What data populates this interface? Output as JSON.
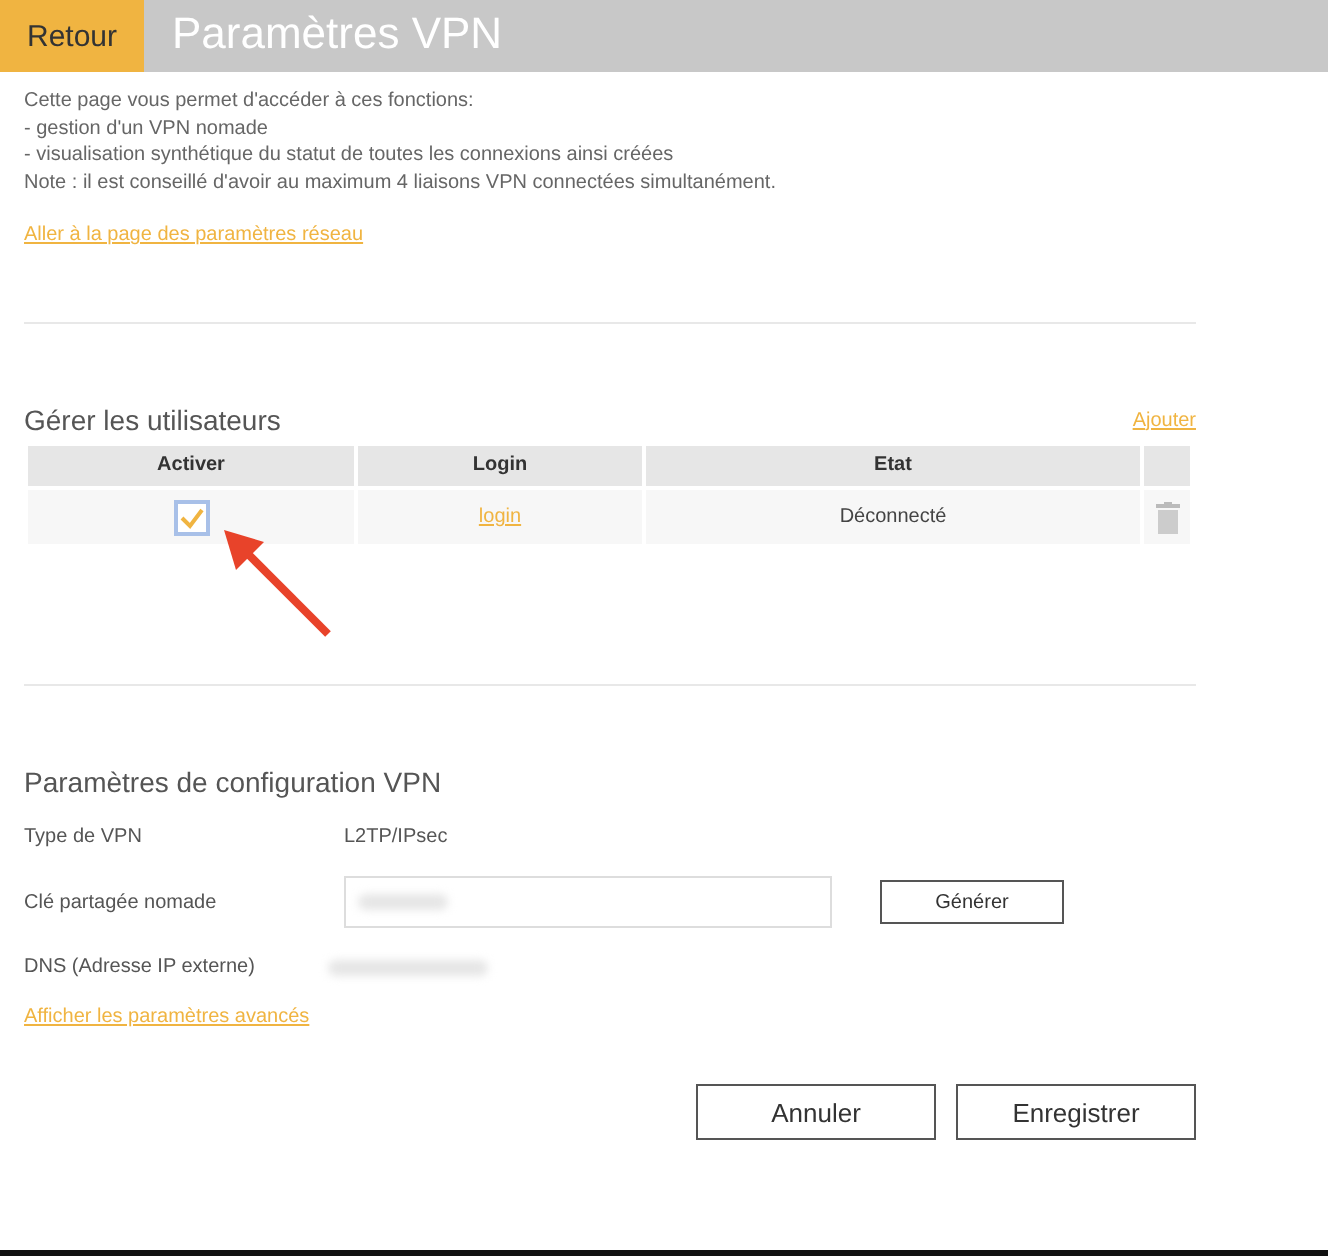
{
  "header": {
    "back_button": "Retour",
    "title": "Paramètres VPN"
  },
  "intro": {
    "lines": [
      "Cette page vous permet d'accéder à ces fonctions:",
      "- gestion d'un VPN nomade",
      "- visualisation synthétique du statut de toutes les connexions ainsi créées",
      "Note : il est conseillé d'avoir au maximum 4 liaisons VPN connectées simultanément."
    ],
    "link": "Aller à la page des paramètres réseau"
  },
  "users": {
    "title": "Gérer les utilisateurs",
    "add_link": "Ajouter",
    "columns": [
      "Activer",
      "Login",
      "Etat"
    ],
    "rows": [
      {
        "checked": true,
        "login": "login",
        "state": "Déconnecté"
      }
    ]
  },
  "config": {
    "title": "Paramètres de configuration VPN",
    "vpn_type_label": "Type de VPN",
    "vpn_type_value": "L2TP/IPsec",
    "key_label": "Clé partagée nomade",
    "generate_button": "Générer",
    "dns_label": "DNS (Adresse IP externe)",
    "advanced_link": "Afficher les paramètres avancés"
  },
  "buttons": [
    "Annuler",
    "Enregistrer"
  ]
}
